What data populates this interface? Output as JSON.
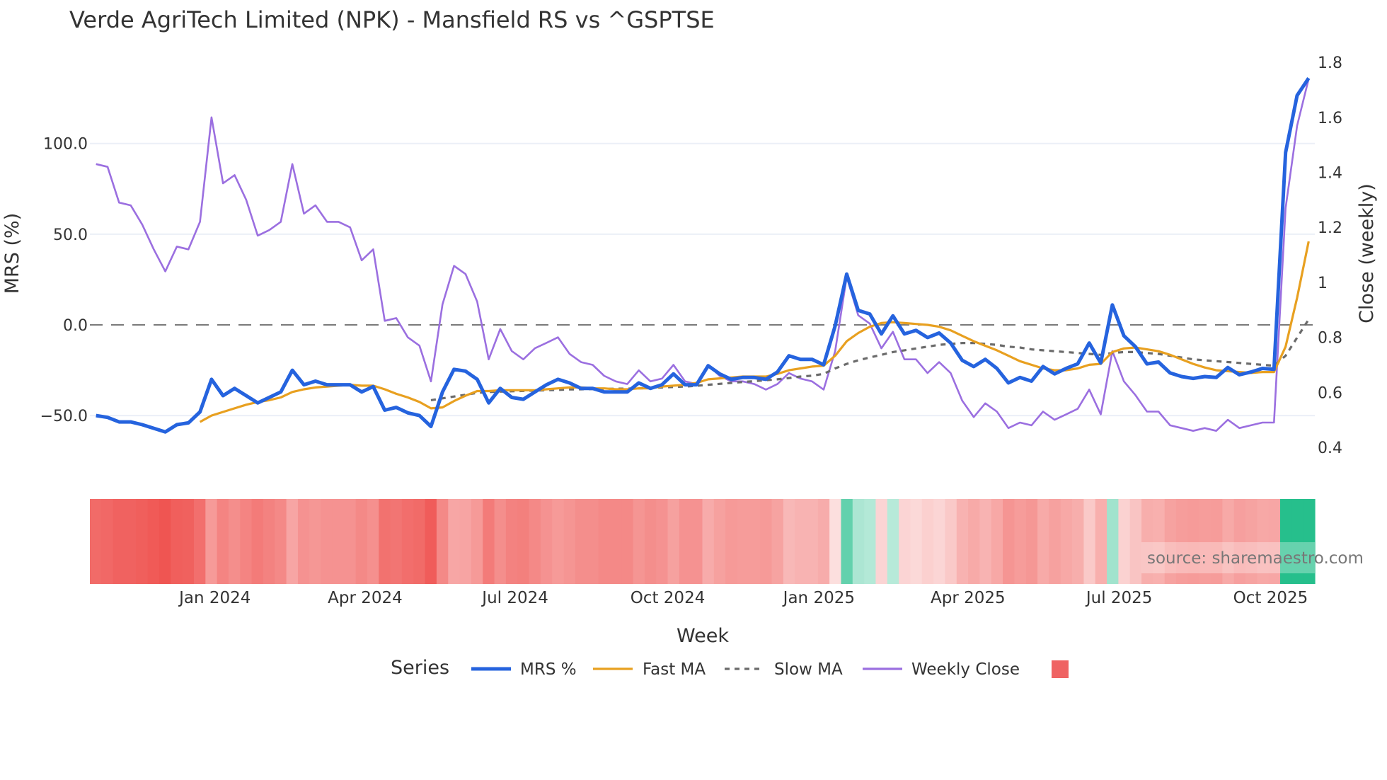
{
  "chart_data": {
    "type": "line",
    "title": "Verde AgriTech Limited (NPK) - Mansfield RS vs ^GSPTSE",
    "xlabel": "Week",
    "ylabel": "MRS (%)",
    "y2label": "Close (weekly)",
    "ylim": [
      -80,
      145
    ],
    "y2lim": [
      0.33,
      1.85
    ],
    "yticks": [
      "100.0",
      "50.0",
      "0.0",
      "−50.0"
    ],
    "ytick_values": [
      100,
      50,
      0,
      -50
    ],
    "y2ticks": [
      "1.8",
      "1.6",
      "1.4",
      "1.2",
      "1",
      "0.8",
      "0.6",
      "0.4"
    ],
    "y2tick_values": [
      1.8,
      1.6,
      1.4,
      1.2,
      1.0,
      0.8,
      0.6,
      0.4
    ],
    "xticks": [
      "Jan 2024",
      "Apr 2024",
      "Jul 2024",
      "Oct 2024",
      "Jan 2025",
      "Apr 2025",
      "Jul 2025",
      "Oct 2025"
    ],
    "xtick_week_index": [
      10.3,
      23.3,
      36.3,
      49.5,
      62.6,
      75.5,
      88.6,
      101.7
    ],
    "grid": true,
    "reference_line": 0,
    "legend_title": "Series",
    "legend_placement": "bottom-center",
    "source": "source: sharemaestro.com",
    "series": [
      {
        "name": "MRS %",
        "color": "#2563de",
        "axis": "left",
        "start": 0,
        "values": [
          -50,
          -51,
          -53.5,
          -53.5,
          -55,
          -57,
          -59,
          -55,
          -54,
          -48,
          -30,
          -39,
          -35,
          -39,
          -43,
          -40,
          -37,
          -25,
          -33,
          -31,
          -33,
          -33,
          -33,
          -37,
          -34,
          -47,
          -45.5,
          -48.5,
          -50,
          -56,
          -37,
          -24.5,
          -25.5,
          -30,
          -43,
          -35,
          -40,
          -41,
          -37,
          -33,
          -30,
          -32,
          -35,
          -35,
          -37,
          -37,
          -37,
          -32,
          -35,
          -33,
          -27,
          -33,
          -33,
          -22.5,
          -27,
          -30,
          -29,
          -29,
          -30,
          -26,
          -17,
          -19,
          -19,
          -22,
          -0.5,
          28,
          8,
          6,
          -5,
          5,
          -5,
          -3,
          -7,
          -4.5,
          -10,
          -19.5,
          -23,
          -19,
          -24,
          -32,
          -29,
          -31,
          -23,
          -27,
          -24,
          -21.5,
          -10,
          -21,
          11,
          -6,
          -12,
          -21.5,
          -20.5,
          -26.5,
          -28.5,
          -29.5,
          -28.5,
          -29,
          -23.5,
          -27.5,
          -26,
          -24,
          -24.5,
          95,
          126.5,
          136
        ]
      },
      {
        "name": "Fast MA",
        "color": "#e8a020",
        "axis": "left",
        "start": 9,
        "values": [
          -53.5,
          -50,
          -48,
          -46,
          -44,
          -42.5,
          -41.5,
          -40,
          -37,
          -35.5,
          -34.5,
          -34,
          -33.5,
          -33,
          -33.5,
          -33.5,
          -35.5,
          -38,
          -40,
          -42.5,
          -46,
          -45.5,
          -42,
          -39,
          -36.5,
          -36.5,
          -36,
          -36,
          -36,
          -36,
          -35.5,
          -35,
          -34.5,
          -34.5,
          -35,
          -35,
          -35.5,
          -35.5,
          -35,
          -35,
          -34,
          -33.5,
          -33,
          -32,
          -30,
          -29.5,
          -29,
          -28.5,
          -28.5,
          -28.5,
          -27,
          -25,
          -24,
          -23,
          -22.5,
          -17,
          -9,
          -4.5,
          -1,
          1,
          1.5,
          1,
          0.5,
          0,
          -1,
          -3,
          -6,
          -9,
          -11.5,
          -14,
          -17,
          -20,
          -22,
          -24,
          -25,
          -25,
          -24,
          -22,
          -21.5,
          -15,
          -13,
          -12.5,
          -13.5,
          -14.5,
          -16.5,
          -19,
          -21.5,
          -23.5,
          -25,
          -25.5,
          -26,
          -26.5,
          -26,
          -26,
          -12,
          15,
          46
        ]
      },
      {
        "name": "Slow MA",
        "color": "#6b6b6b",
        "axis": "left",
        "dash": true,
        "start": 29,
        "values": [
          -41.5,
          -40.5,
          -39.5,
          -38.5,
          -37.5,
          -37,
          -36.8,
          -36.6,
          -36.4,
          -36.2,
          -36,
          -35.8,
          -35.6,
          -35.5,
          -35.4,
          -35.3,
          -35.2,
          -35.1,
          -35,
          -34.8,
          -34.5,
          -34.2,
          -34,
          -33.6,
          -33,
          -32.5,
          -32,
          -31.5,
          -31,
          -30.5,
          -30,
          -29.3,
          -28.5,
          -28,
          -27,
          -24,
          -21.5,
          -19.5,
          -18,
          -16.5,
          -15,
          -14,
          -13,
          -12,
          -11,
          -10.5,
          -10,
          -10,
          -10.5,
          -11,
          -12,
          -12.5,
          -13.5,
          -14,
          -14.5,
          -15,
          -15.5,
          -16,
          -16.5,
          -15.5,
          -15,
          -15,
          -15.5,
          -16,
          -17,
          -18,
          -19,
          -19.5,
          -20,
          -20.5,
          -21,
          -21.5,
          -22,
          -22.5,
          -17,
          -7,
          3
        ]
      },
      {
        "name": "Weekly Close",
        "color": "#9b6fe0",
        "axis": "right",
        "start": 0,
        "values": [
          1.43,
          1.42,
          1.29,
          1.28,
          1.21,
          1.12,
          1.04,
          1.13,
          1.12,
          1.22,
          1.6,
          1.36,
          1.39,
          1.3,
          1.17,
          1.19,
          1.22,
          1.43,
          1.25,
          1.28,
          1.22,
          1.22,
          1.2,
          1.08,
          1.12,
          0.86,
          0.87,
          0.8,
          0.77,
          0.64,
          0.92,
          1.06,
          1.03,
          0.93,
          0.72,
          0.83,
          0.75,
          0.72,
          0.76,
          0.78,
          0.8,
          0.74,
          0.71,
          0.7,
          0.66,
          0.64,
          0.63,
          0.68,
          0.64,
          0.65,
          0.7,
          0.64,
          0.63,
          0.7,
          0.66,
          0.64,
          0.64,
          0.63,
          0.61,
          0.63,
          0.67,
          0.65,
          0.64,
          0.61,
          0.75,
          1.02,
          0.88,
          0.85,
          0.76,
          0.82,
          0.72,
          0.72,
          0.67,
          0.71,
          0.67,
          0.57,
          0.51,
          0.56,
          0.53,
          0.47,
          0.49,
          0.48,
          0.53,
          0.5,
          0.52,
          0.54,
          0.61,
          0.52,
          0.75,
          0.64,
          0.59,
          0.53,
          0.53,
          0.48,
          0.47,
          0.46,
          0.47,
          0.46,
          0.5,
          0.47,
          0.48,
          0.49,
          0.49,
          1.27,
          1.57,
          1.74
        ]
      }
    ],
    "heatmap": {
      "based_on": "MRS %",
      "negative_color": "#ef5350",
      "positive_color": "#26bf8c",
      "legend_color": "#ef6363"
    }
  }
}
